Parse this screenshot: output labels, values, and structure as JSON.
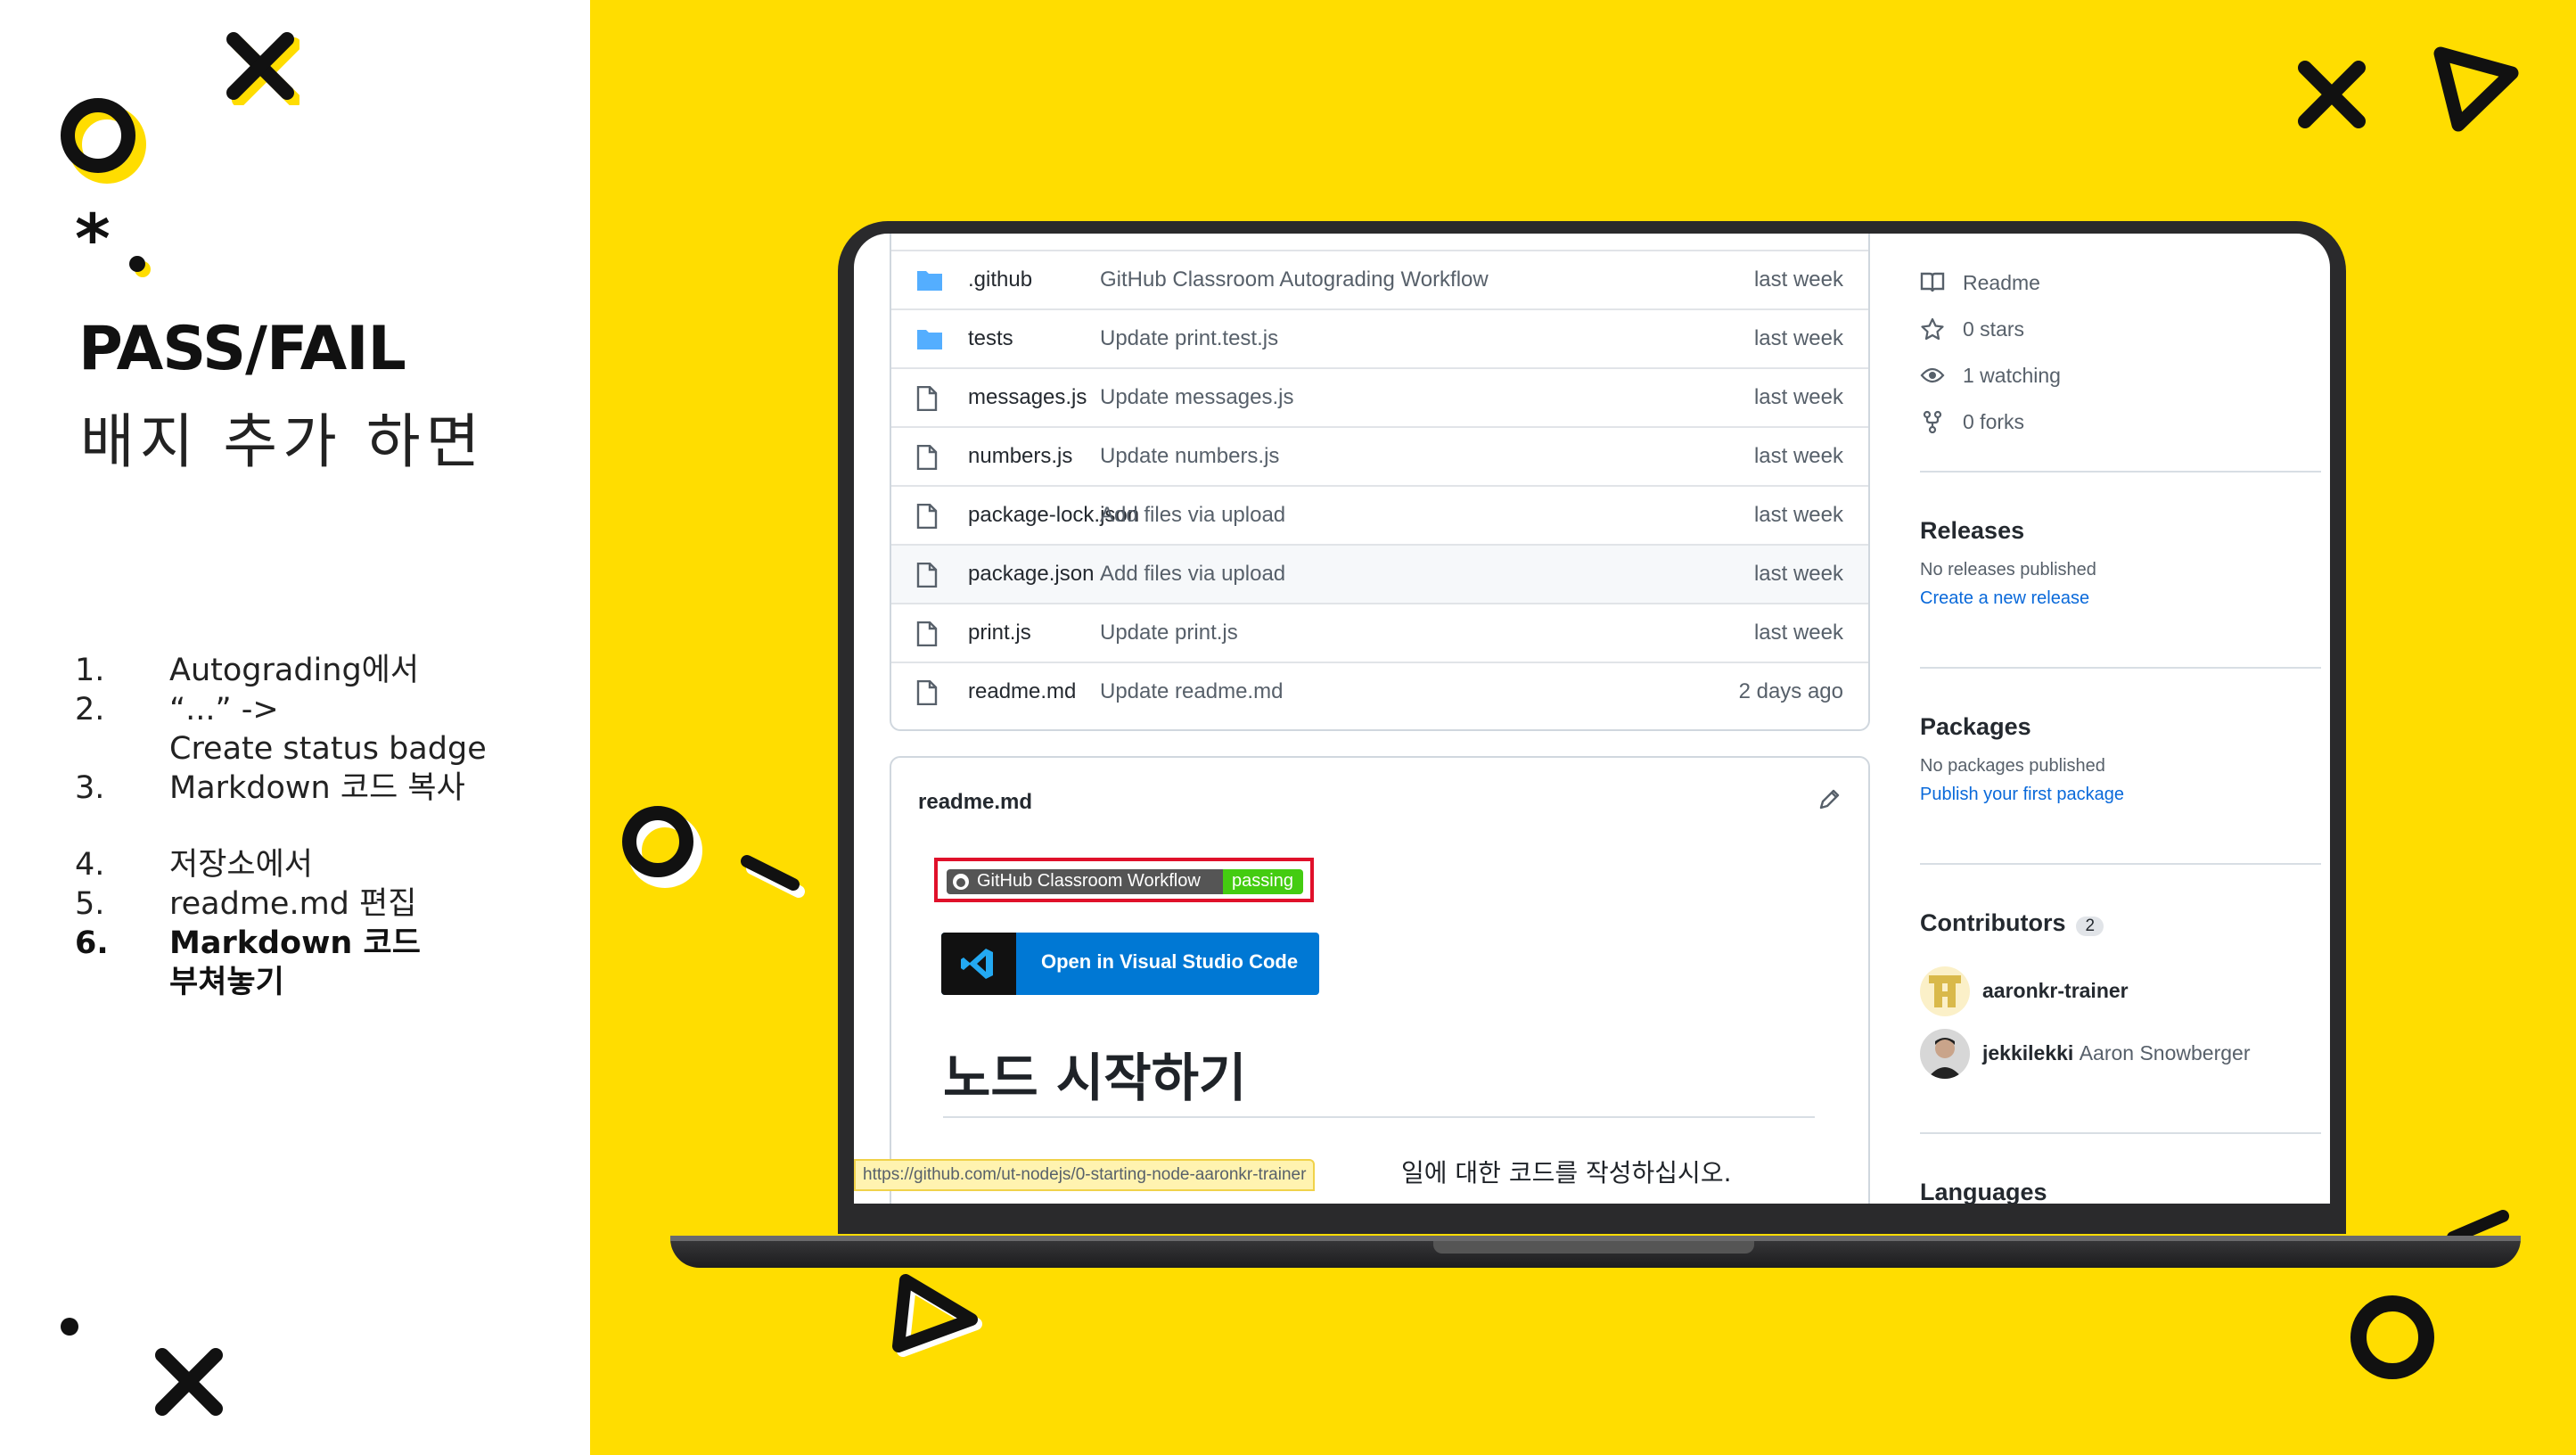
{
  "slide": {
    "title": "PASS/FAIL",
    "subtitle": "배지 추가 하면",
    "steps": [
      {
        "num": "1.",
        "text": "Autograding에서"
      },
      {
        "num": "2.",
        "text": "“...” ->"
      },
      {
        "num": "",
        "text": "Create status badge"
      },
      {
        "num": "3.",
        "text": "Markdown 코드 복사"
      },
      {
        "num": "4.",
        "text": "저장소에서"
      },
      {
        "num": "5.",
        "text": "readme.md 편집"
      },
      {
        "num": "6.",
        "text": "Markdown 코드"
      },
      {
        "num": "",
        "text": "부쳐놓기"
      }
    ]
  },
  "files": [
    {
      "name": ".github",
      "message": "GitHub Classroom Autograding Workflow",
      "time": "last week",
      "type": "folder"
    },
    {
      "name": "tests",
      "message": "Update print.test.js",
      "time": "last week",
      "type": "folder"
    },
    {
      "name": "messages.js",
      "message": "Update messages.js",
      "time": "last week",
      "type": "file"
    },
    {
      "name": "numbers.js",
      "message": "Update numbers.js",
      "time": "last week",
      "type": "file"
    },
    {
      "name": "package-lock.json",
      "message": "Add files via upload",
      "time": "last week",
      "type": "file"
    },
    {
      "name": "package.json",
      "message": "Add files via upload",
      "time": "last week",
      "type": "file"
    },
    {
      "name": "print.js",
      "message": "Update print.js",
      "time": "last week",
      "type": "file"
    },
    {
      "name": "readme.md",
      "message": "Update readme.md",
      "time": "2 days ago",
      "type": "file"
    }
  ],
  "readme": {
    "title": "readme.md",
    "badge_left": "GitHub Classroom Workflow",
    "badge_right": "passing",
    "vscode_label": "Open in Visual Studio Code",
    "heading": "노드 시작하기",
    "paragraph_tail": "일에 대한 코드를 작성하십시오."
  },
  "status_url": "https://github.com/ut-nodejs/0-starting-node-aaronkr-trainer",
  "sidebar": {
    "readme": "Readme",
    "stars": "0 stars",
    "watching": "1 watching",
    "forks": "0 forks",
    "releases_heading": "Releases",
    "releases_none": "No releases published",
    "releases_link": "Create a new release",
    "packages_heading": "Packages",
    "packages_none": "No packages published",
    "packages_link": "Publish your first package",
    "contributors_heading": "Contributors",
    "contributors_count": "2",
    "contributors": [
      {
        "login": "aaronkr-trainer",
        "name": ""
      },
      {
        "login": "jekkilekki",
        "name": "Aaron Snowberger"
      }
    ],
    "languages_heading": "Languages"
  },
  "colors": {
    "accent_yellow": "#FFDD00",
    "badge_pass": "#44CC11",
    "vscode_blue": "#0078D4",
    "highlight_red": "#E0102A"
  }
}
